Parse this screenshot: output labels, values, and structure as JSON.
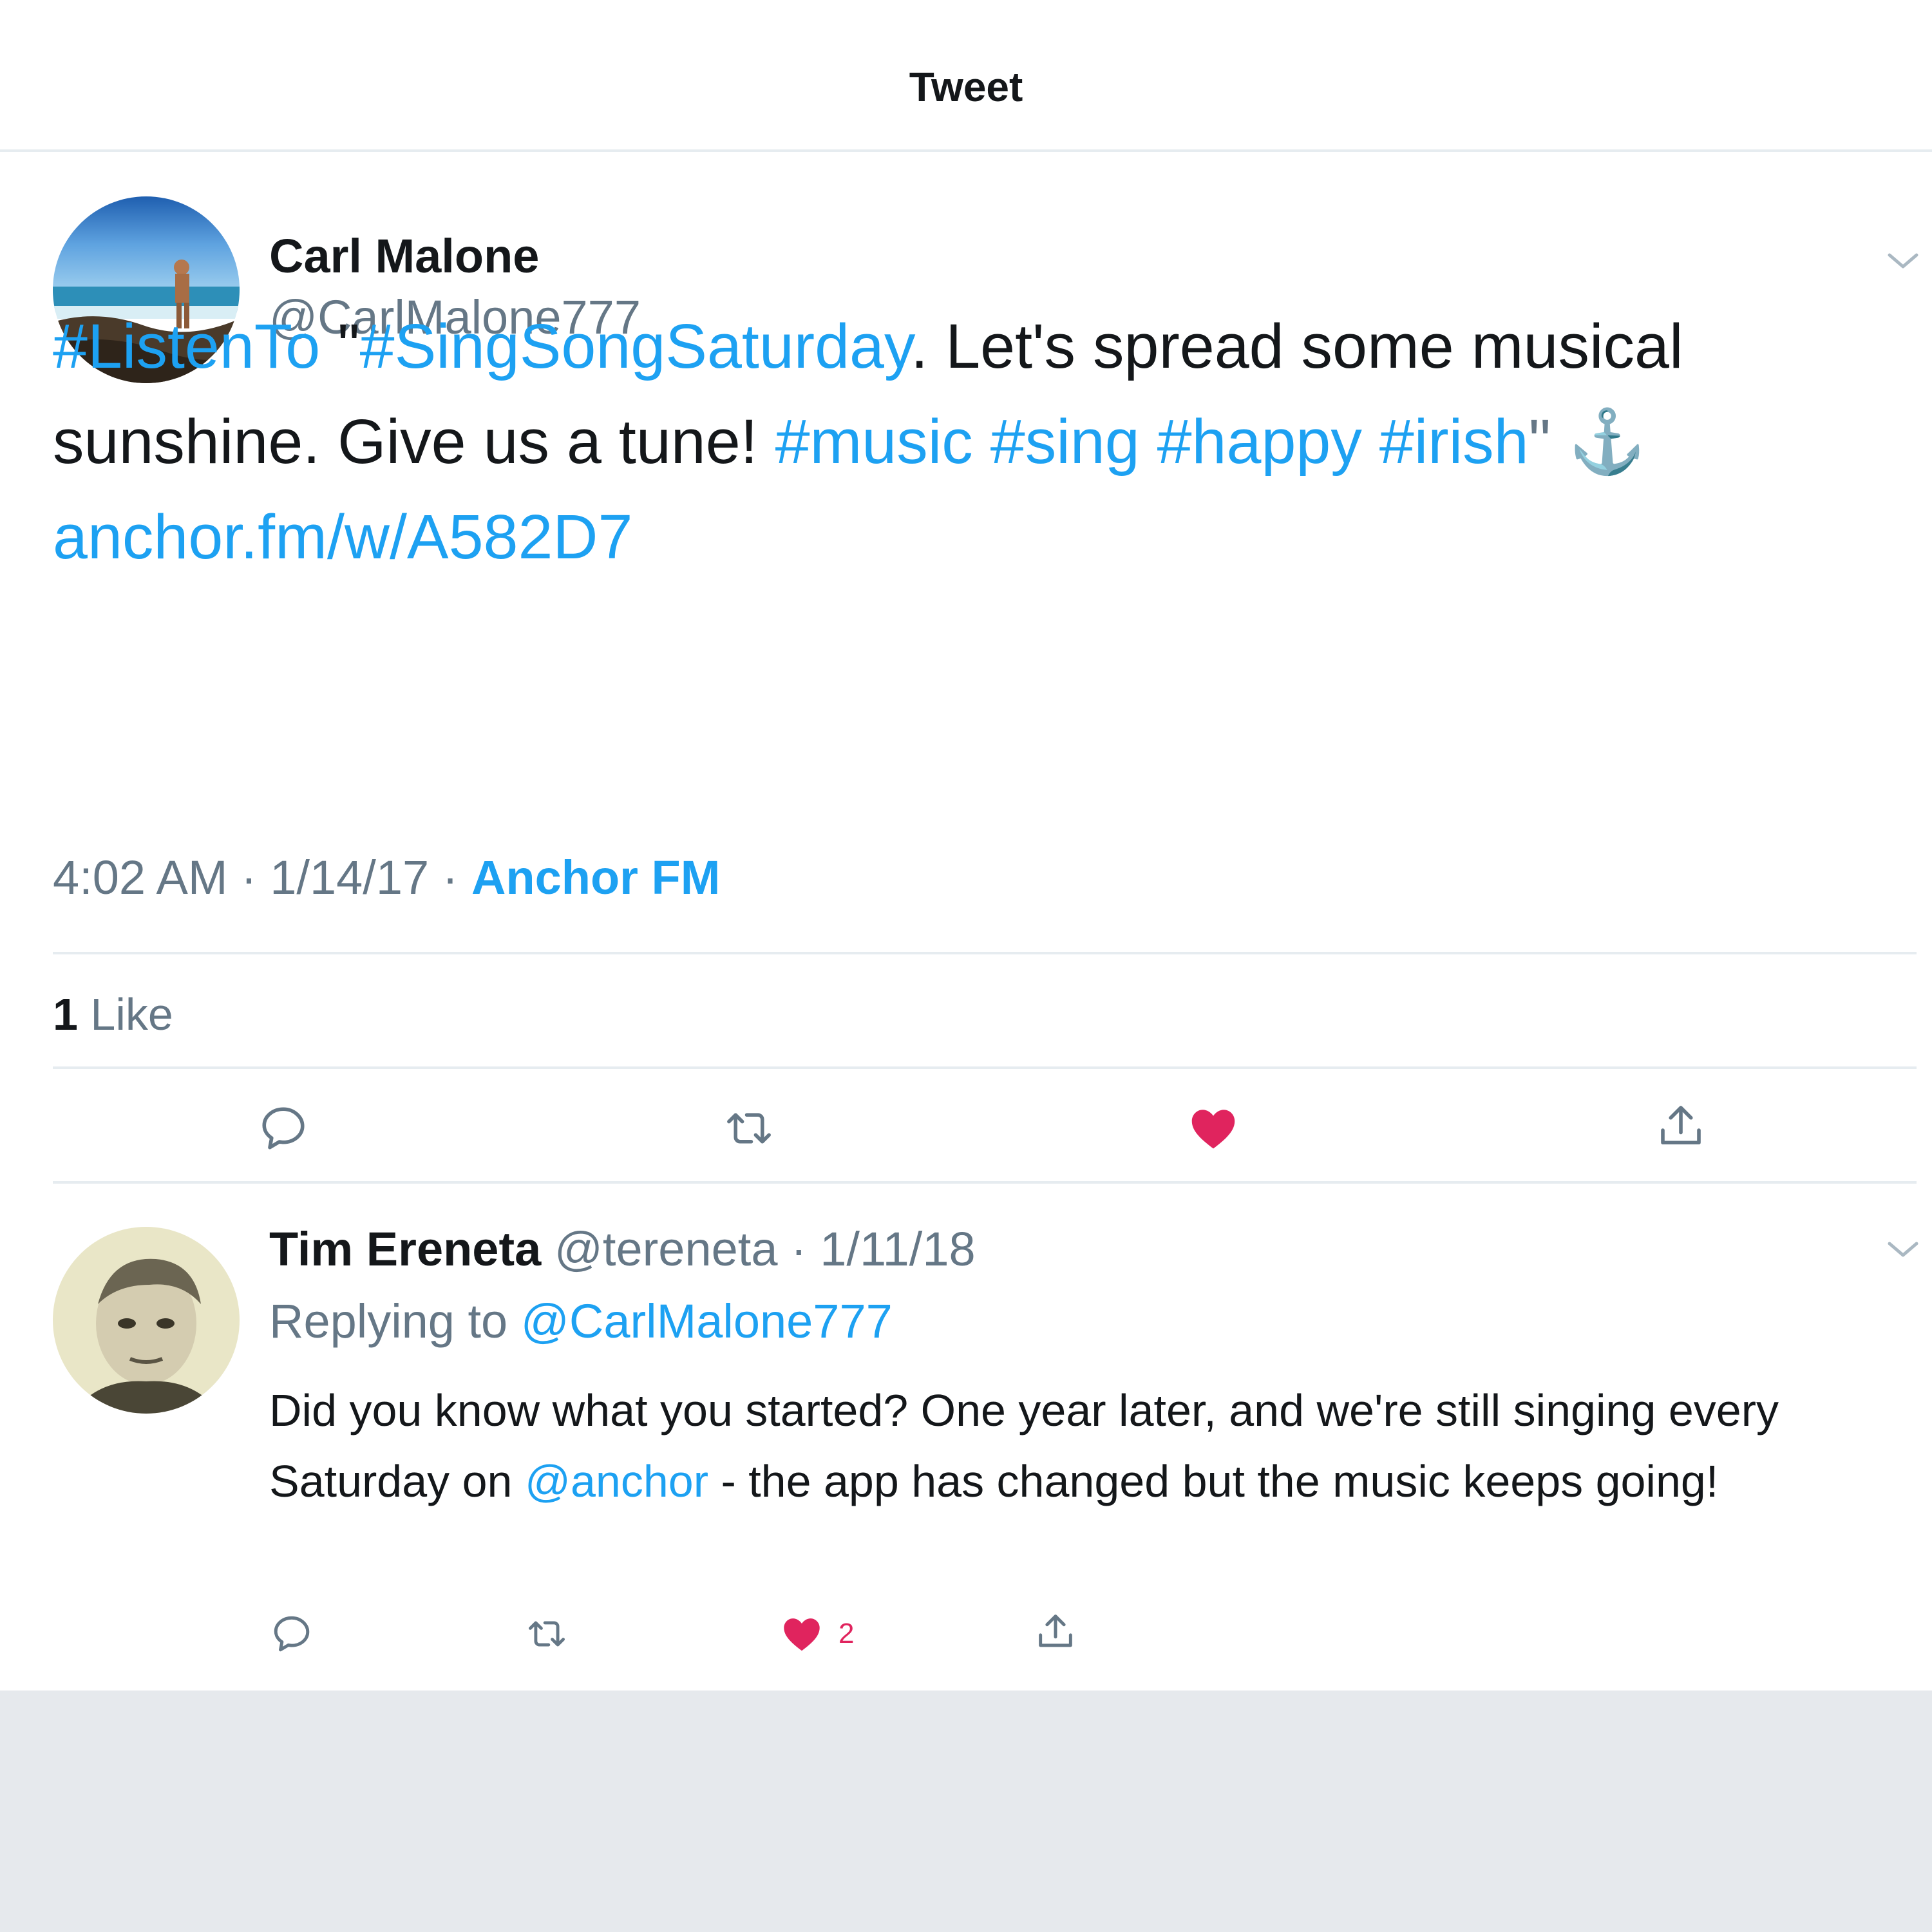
{
  "header": {
    "title": "Tweet"
  },
  "tweet": {
    "author_name": "Carl Malone",
    "author_handle": "@CarlMalone777",
    "text": {
      "p1": "#ListenTo",
      "p2": " \"",
      "p3": "#SingSongSaturday",
      "p4": ". Let's  spread some musical sunshine. Give us a tune! ",
      "p5": "#music #sing #happy #irish",
      "p6": "\" ⚓ ",
      "p7": "anchor.fm/w/A582D7"
    },
    "time": "4:02 AM",
    "sep1": " · ",
    "date": "1/14/17",
    "sep2": " · ",
    "source": "Anchor FM",
    "like_count": "1",
    "like_label": " Like",
    "liked": true
  },
  "reply": {
    "author_name": "Tim Ereneta",
    "author_handle": "@tereneta",
    "sep": " · ",
    "date": "1/11/18",
    "replying_label": "Replying to ",
    "replying_handle": "@CarlMalone777",
    "text": {
      "p1": "Did you know what you started? One year later, and we're still singing every Saturday on ",
      "p2": "@anchor",
      "p3": " - the app has changed but the music keeps going!"
    },
    "like_count": "2"
  },
  "icons": {
    "reply": "reply-icon",
    "retweet": "retweet-icon",
    "like": "heart-icon",
    "share": "share-icon",
    "more": "chevron-down-icon"
  },
  "colors": {
    "link": "#1da1f2",
    "secondary_text": "#657786",
    "like": "#e0245e",
    "divider": "#e6ecf0",
    "footer": "#e6e9ed"
  }
}
